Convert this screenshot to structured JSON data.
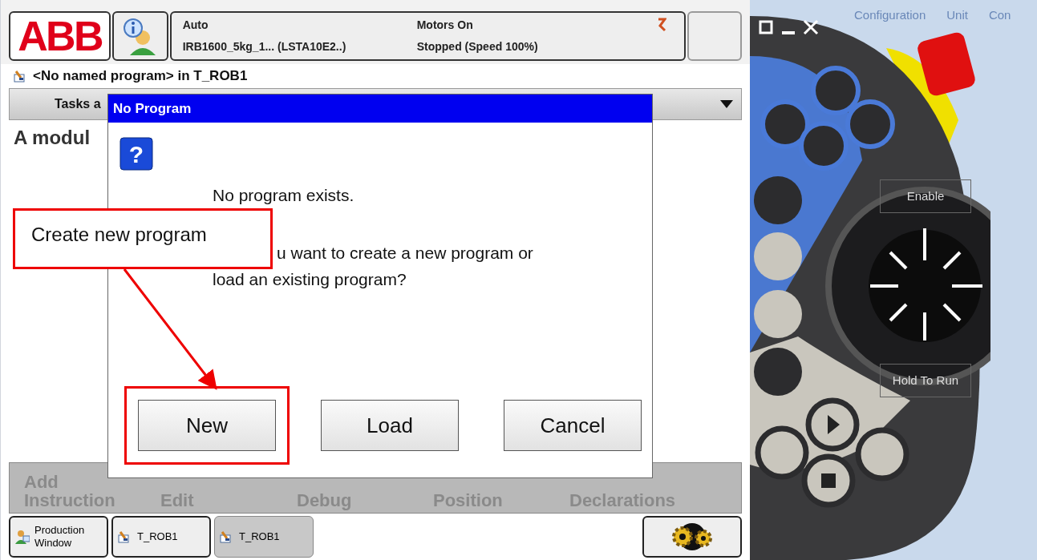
{
  "header": {
    "logo": "ABB",
    "mode": "Auto",
    "controller": "IRB1600_5kg_1... (LSTA10E2..)",
    "motors": "Motors On",
    "state": "Stopped (Speed 100%)"
  },
  "program_title": "<No named program> in T_ROB1",
  "tab_label": "Tasks a",
  "content_text": "A modul",
  "dialog": {
    "title": "No Program",
    "icon": "?",
    "message_lines": [
      "No program exists.",
      "u want to create a new program or",
      "load an existing program?"
    ],
    "buttons": [
      {
        "label": "New",
        "highlighted": true
      },
      {
        "label": "Load",
        "highlighted": false
      },
      {
        "label": "Cancel",
        "highlighted": false
      }
    ]
  },
  "callout": {
    "text": "Create new program"
  },
  "bottom_menu": [
    {
      "label": "Add Instruction",
      "disabled": true
    },
    {
      "label": "Edit",
      "disabled": true
    },
    {
      "label": "Debug",
      "disabled": true
    },
    {
      "label": "Position",
      "disabled": true
    },
    {
      "label": "Declarations",
      "disabled": true
    }
  ],
  "taskbar": [
    {
      "label": "Production Window",
      "kind": "production",
      "selected": false
    },
    {
      "label": "T_ROB1",
      "kind": "task",
      "selected": false
    },
    {
      "label": "T_ROB1",
      "kind": "task",
      "selected": true
    }
  ],
  "pendant": {
    "background_tabs": [
      "Configuration",
      "Unit",
      "Con"
    ],
    "enable_label": "Enable",
    "hold_label": "Hold To Run"
  }
}
